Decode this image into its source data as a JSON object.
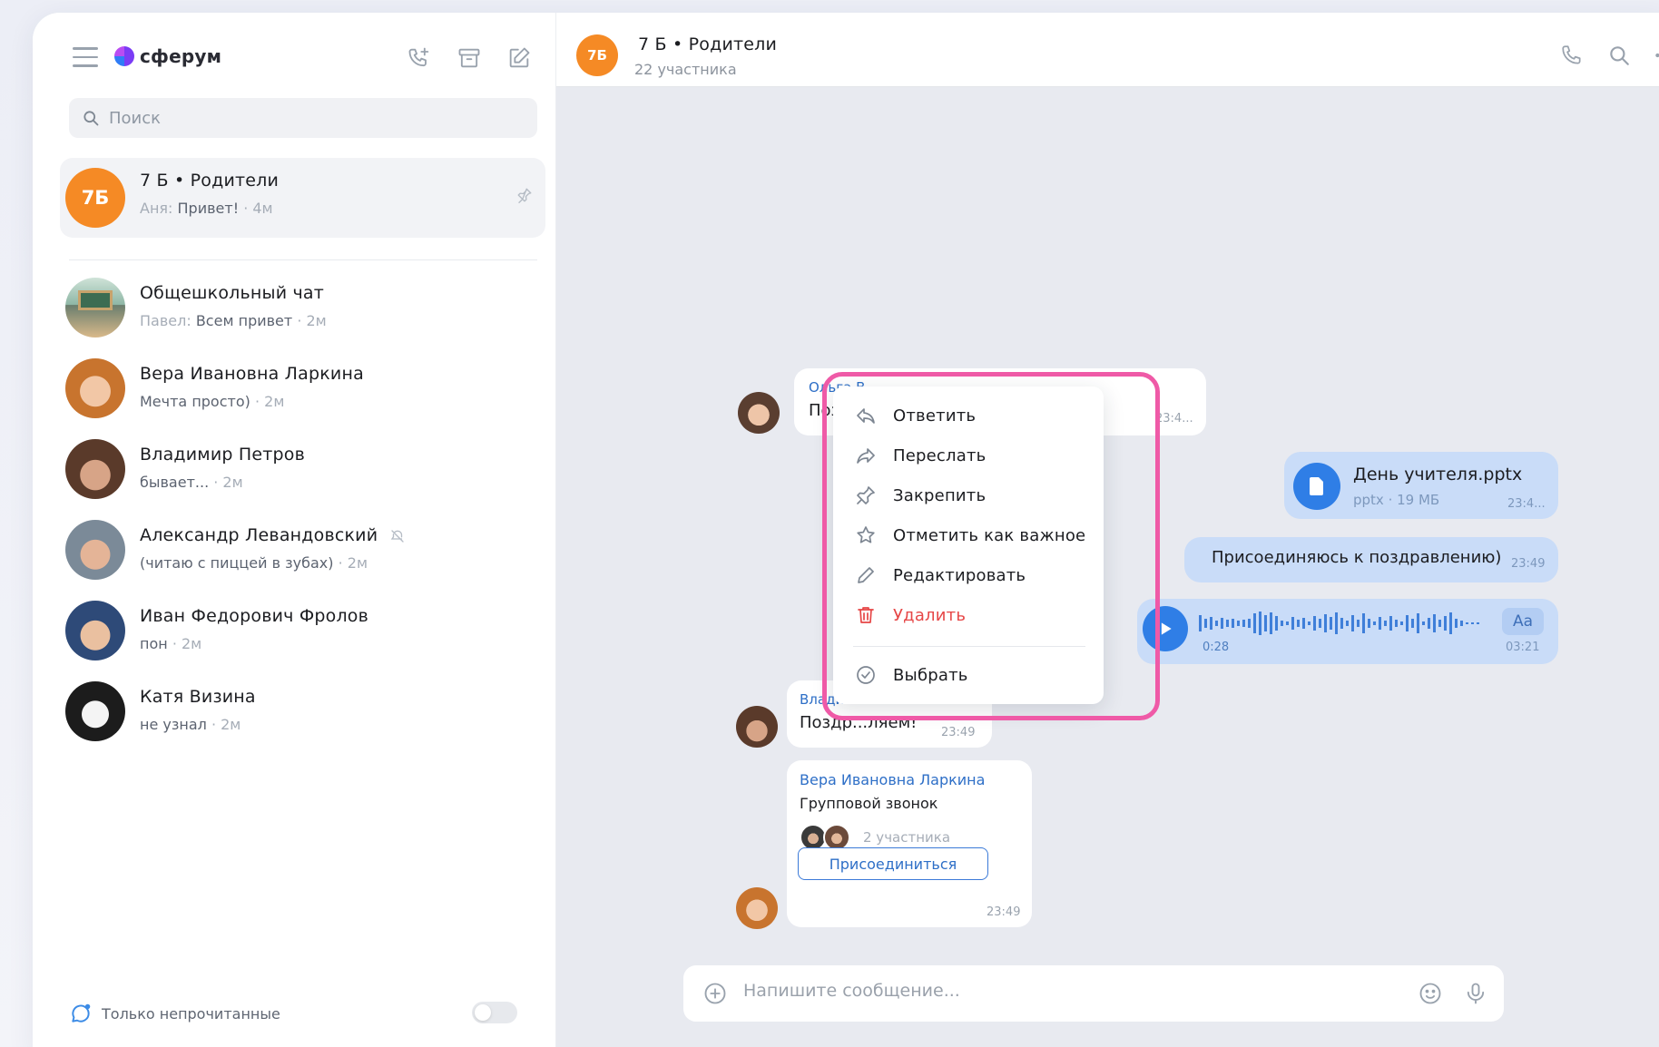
{
  "app": {
    "logo_text": "сферум"
  },
  "sidebar": {
    "search_placeholder": "Поиск",
    "chats": [
      {
        "name": "7 Б • Родители",
        "avatar_text": "7Б",
        "sender": "Аня:",
        "preview": "Привет!",
        "time": "· 4м",
        "pinned": true
      },
      {
        "name": "Общешкольный чат",
        "sender": "Павел:",
        "preview": "Всем привет",
        "time": "· 2м"
      },
      {
        "name": "Вера Ивановна Ларкина",
        "sender": "",
        "preview": "Мечта просто)",
        "time": "· 2м"
      },
      {
        "name": "Владимир Петров",
        "sender": "",
        "preview": "бывает...",
        "time": "· 2м"
      },
      {
        "name": "Александр Левандовский",
        "sender": "",
        "preview": "(читаю с пиццей в зубах)",
        "time": "· 2м",
        "muted": true
      },
      {
        "name": "Иван Федорович Фролов",
        "sender": "",
        "preview": "пон",
        "time": "· 2м"
      },
      {
        "name": "Катя Визина",
        "sender": "",
        "preview": "не узнал",
        "time": "· 2м"
      }
    ],
    "footer_label": "Только непрочитанные"
  },
  "chat": {
    "avatar_text": "7Б",
    "title": "7 Б • Родители",
    "subtitle": "22 участника",
    "messages": {
      "olga": {
        "sender": "Ольга В...",
        "text": "Позд...",
        "time": "23:4..."
      },
      "file": {
        "name": "День учителя.pptx",
        "meta": "pptx · 19 МБ",
        "time": "23:4..."
      },
      "join_text": {
        "text": "Присоединяюсь к поздравлению)",
        "time": "23:49"
      },
      "voice": {
        "duration": "0:28",
        "aa": "Аа",
        "time": "03:21"
      },
      "vlad": {
        "sender": "Влади...",
        "text": "Поздр...ляем!",
        "time": "23:49"
      },
      "call": {
        "sender": "Вера Ивановна Ларкина",
        "title": "Групповой звонок",
        "participants": "2 участника",
        "button": "Присоединиться",
        "time": "23:49"
      }
    },
    "composer_placeholder": "Напишите сообщение..."
  },
  "context_menu": {
    "reply": "Ответить",
    "forward": "Переслать",
    "pin": "Закрепить",
    "important": "Отметить как важное",
    "edit": "Редактировать",
    "delete": "Удалить",
    "select": "Выбрать"
  },
  "colors": {
    "accent": "#2e6fc7",
    "highlight": "#ef5aa7",
    "avatar_orange": "#f58a25",
    "danger": "#e64646",
    "bubble_blue": "#c9dcf8"
  }
}
